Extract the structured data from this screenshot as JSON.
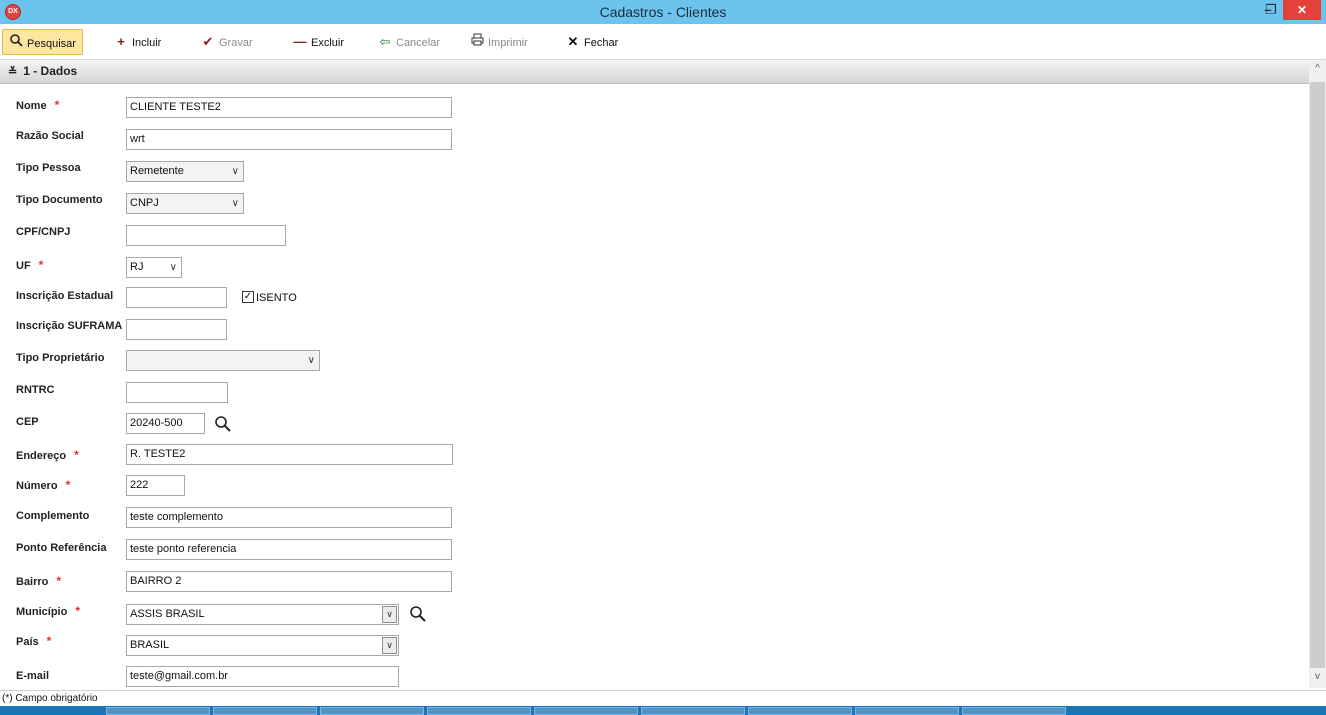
{
  "window": {
    "title": "Cadastros - Clientes",
    "logo_text": "DX",
    "minimize_label": "–",
    "restore_label": "❐",
    "close_label": "✕"
  },
  "toolbar": {
    "pesquisar": "Pesquisar",
    "incluir": "Incluir",
    "gravar": "Gravar",
    "excluir": "Excluir",
    "cancelar": "Cancelar",
    "imprimir": "Imprimir",
    "fechar": "Fechar"
  },
  "section": {
    "title": "1 - Dados"
  },
  "form": {
    "nome": {
      "label": "Nome",
      "value": "CLIENTE TESTE2"
    },
    "razao_social": {
      "label": "Razão Social",
      "value": "wrt"
    },
    "tipo_pessoa": {
      "label": "Tipo Pessoa",
      "value": "Remetente"
    },
    "tipo_documento": {
      "label": "Tipo Documento",
      "value": "CNPJ"
    },
    "cpf_cnpj": {
      "label": "CPF/CNPJ",
      "value": ""
    },
    "uf": {
      "label": "UF",
      "value": "RJ"
    },
    "inscricao_estadual": {
      "label": "Inscrição Estadual",
      "value": "",
      "isento_label": "ISENTO",
      "isento_checked": true
    },
    "inscricao_suframa": {
      "label": "Inscrição SUFRAMA",
      "value": ""
    },
    "tipo_proprietario": {
      "label": "Tipo Proprietário",
      "value": ""
    },
    "rntrc": {
      "label": "RNTRC",
      "value": ""
    },
    "cep": {
      "label": "CEP",
      "value": "20240-500"
    },
    "endereco": {
      "label": "Endereço",
      "value": "R. TESTE2"
    },
    "numero": {
      "label": "Número",
      "value": "222"
    },
    "complemento": {
      "label": "Complemento",
      "value": "teste complemento"
    },
    "ponto_referencia": {
      "label": "Ponto Referência",
      "value": "teste ponto referencia"
    },
    "bairro": {
      "label": "Bairro",
      "value": "BAIRRO 2"
    },
    "municipio": {
      "label": "Município",
      "value": "ASSIS BRASIL"
    },
    "pais": {
      "label": "País",
      "value": "BRASIL"
    },
    "email": {
      "label": "E-mail",
      "value": "teste@gmail.com.br"
    }
  },
  "required_marker": "*",
  "footer": {
    "note": "(*) Campo obrigatório"
  },
  "colors": {
    "titlebar": "#6cc3ee",
    "required": "#e0302b",
    "close": "#e5413b",
    "taskbar": "#1b74b6"
  }
}
